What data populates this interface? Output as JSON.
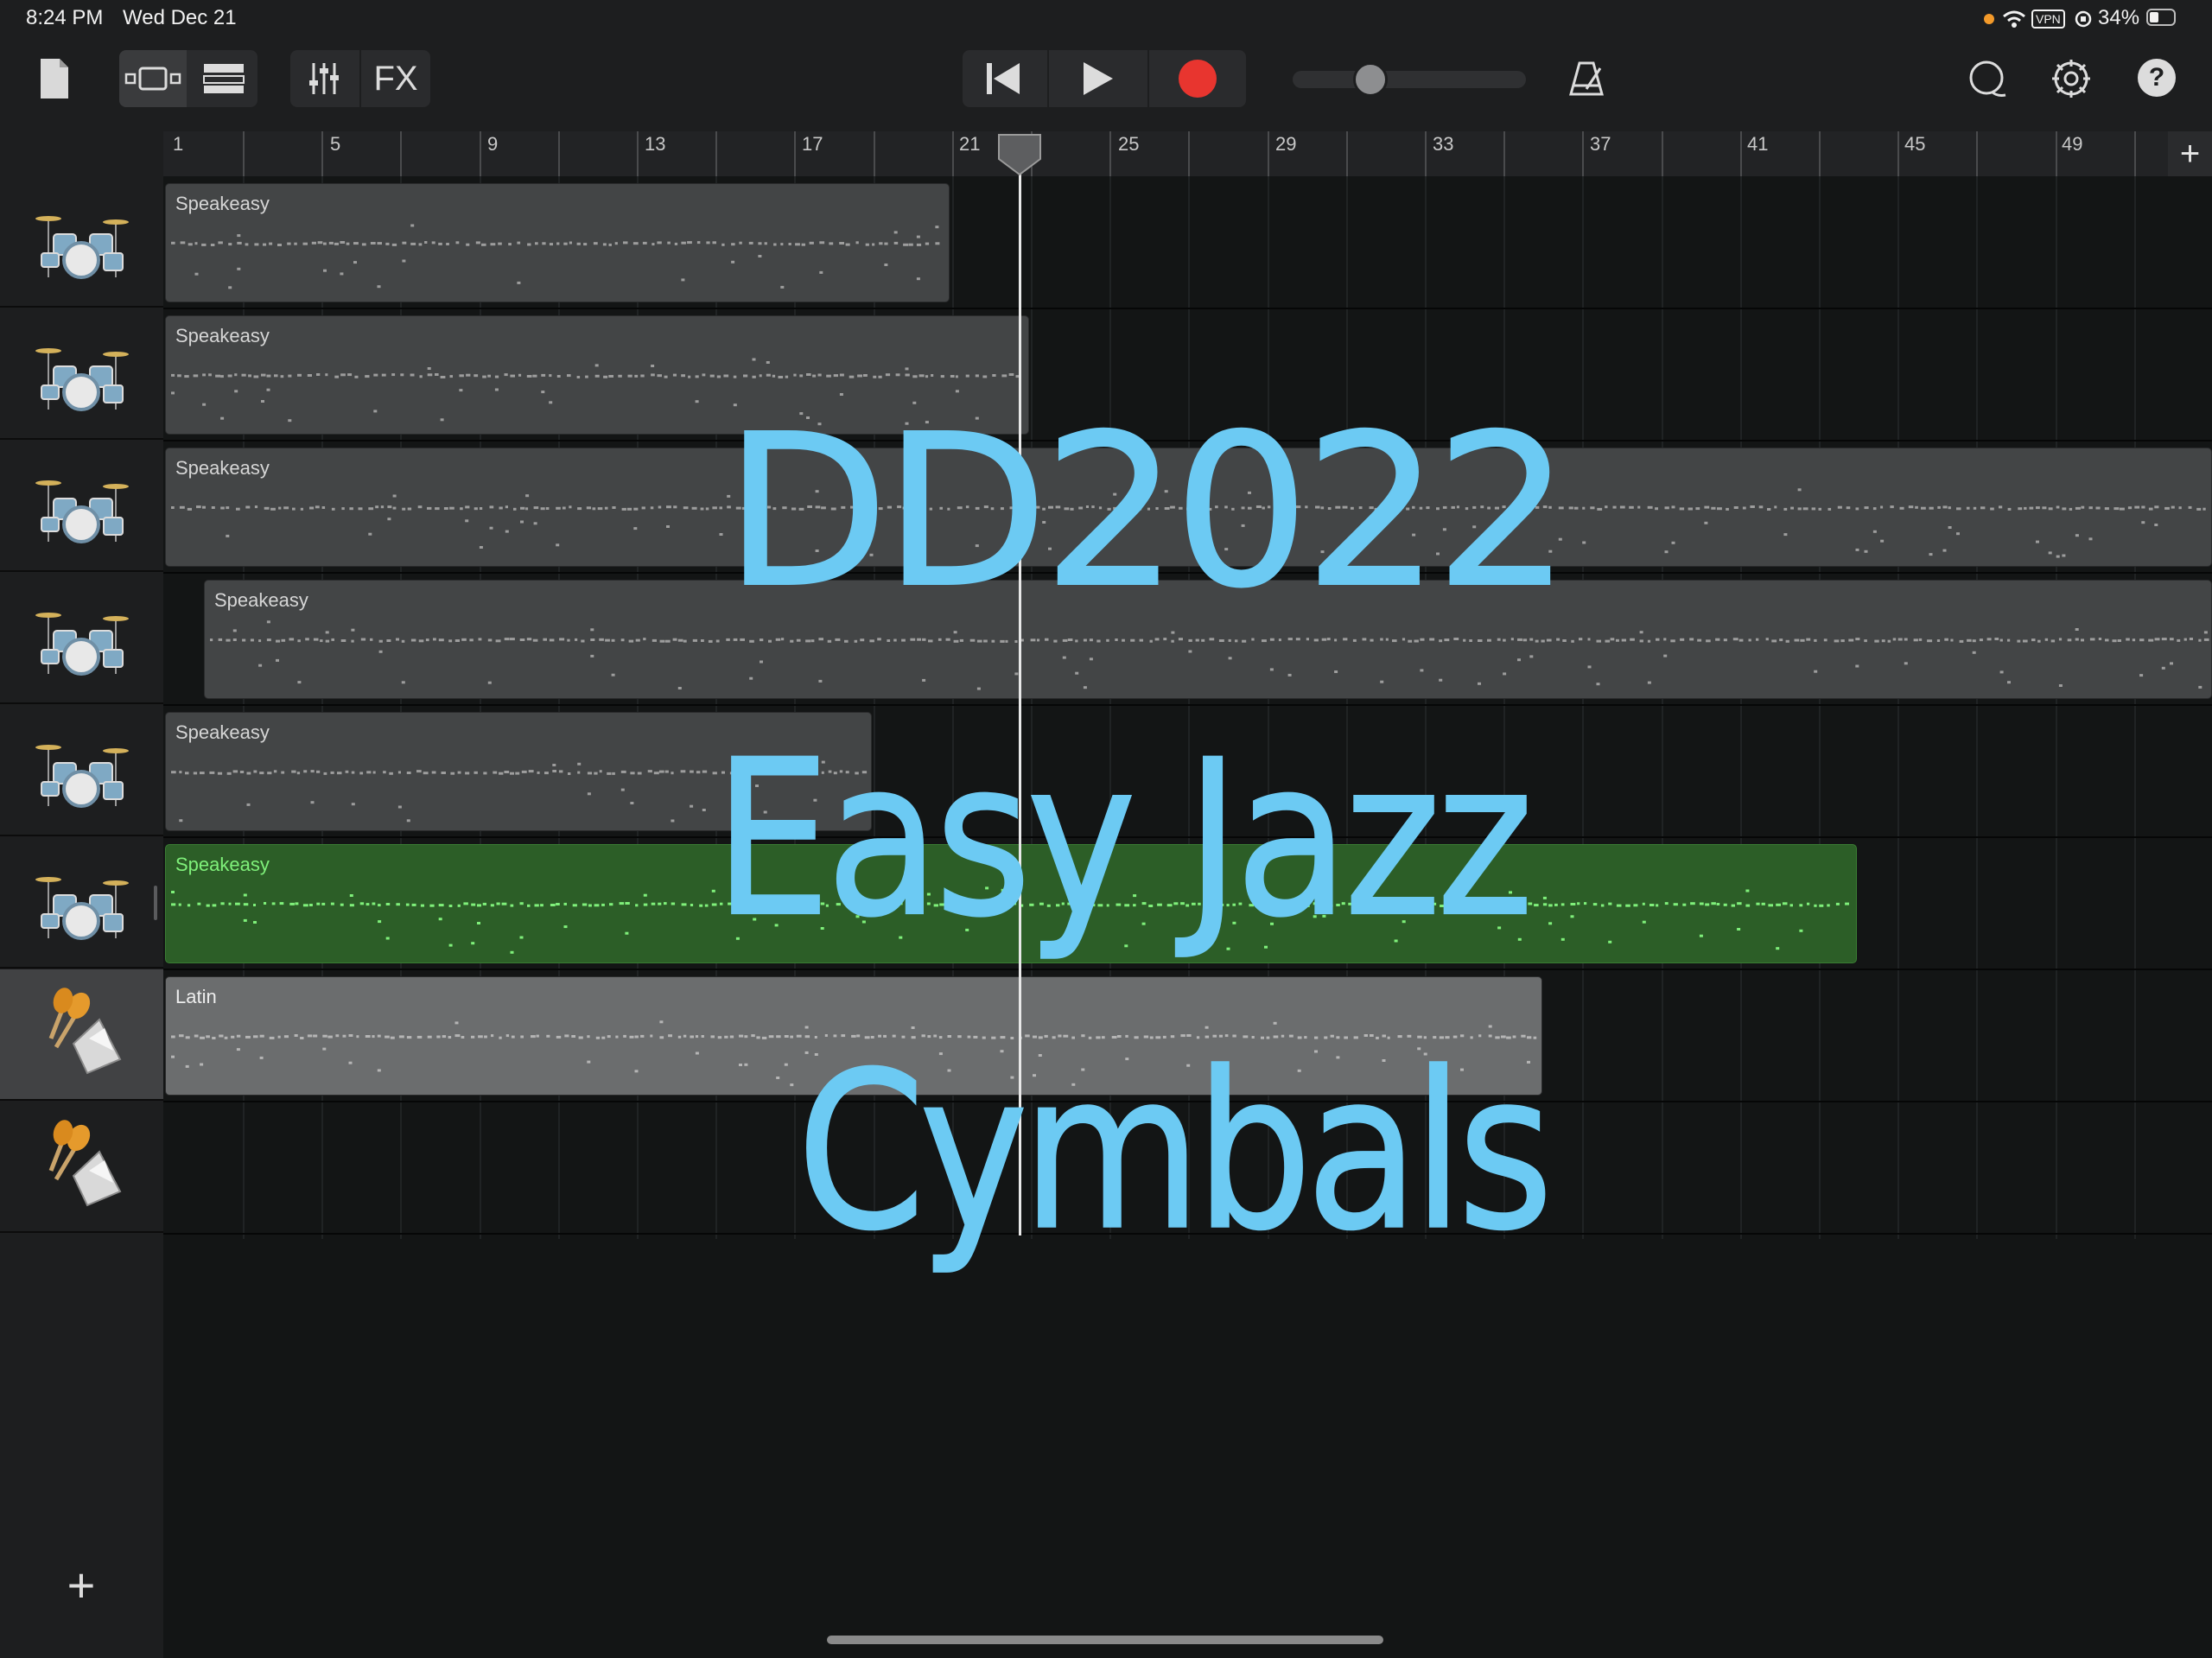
{
  "status_bar": {
    "time": "8:24 PM",
    "date": "Wed Dec 21",
    "vpn": "VPN",
    "battery": "34%"
  },
  "toolbar": {
    "fx_label": "FX",
    "icons": [
      "document-icon",
      "view-toggle-icon",
      "tracks-view-icon",
      "mixer-icon",
      "rewind-icon",
      "play-icon",
      "record-icon",
      "metronome-icon",
      "loop-icon",
      "settings-icon",
      "help-icon"
    ],
    "record_color": "#e8352f",
    "help_label": "?"
  },
  "ruler": {
    "bars": [
      "1",
      "5",
      "9",
      "13",
      "17",
      "21",
      "25",
      "29",
      "33",
      "37",
      "41",
      "45",
      "49"
    ],
    "add_label": "+"
  },
  "tracks": [
    {
      "instrument": "drum-kit",
      "region": "Speakeasy"
    },
    {
      "instrument": "drum-kit",
      "region": "Speakeasy"
    },
    {
      "instrument": "drum-kit",
      "region": "Speakeasy"
    },
    {
      "instrument": "drum-kit",
      "region": "Speakeasy"
    },
    {
      "instrument": "drum-kit",
      "region": "Speakeasy"
    },
    {
      "instrument": "drum-kit",
      "region": "Speakeasy"
    },
    {
      "instrument": "percussion",
      "region": "Latin"
    },
    {
      "instrument": "percussion",
      "region": ""
    }
  ],
  "add_track_label": "+",
  "overlay": {
    "line1": "DD2022",
    "line2": "Easy Jazz",
    "line3": "Cymbals",
    "color": "#6ccaf3"
  },
  "colors": {
    "selected_region": "#2c5e27",
    "region": "#434546",
    "accent_green": "#7ff07a"
  }
}
